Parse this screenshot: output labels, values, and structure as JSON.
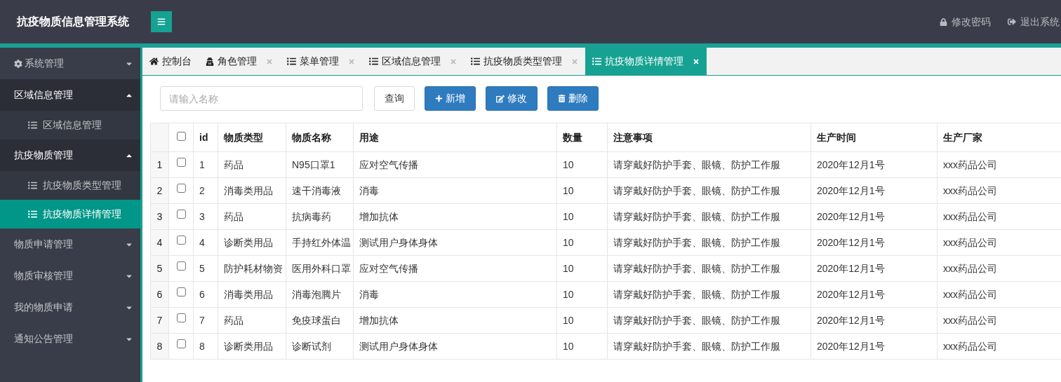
{
  "header": {
    "title": "抗疫物质信息管理系统",
    "links": [
      {
        "label": "修改密码"
      },
      {
        "label": "退出系统"
      }
    ]
  },
  "sidebar": {
    "items": [
      {
        "label": "系统管理",
        "expanded": false
      },
      {
        "label": "区域信息管理",
        "expanded": true,
        "children": [
          {
            "label": "区域信息管理",
            "selected": false
          }
        ]
      },
      {
        "label": "抗疫物质管理",
        "expanded": true,
        "children": [
          {
            "label": "抗疫物质类型管理",
            "selected": false
          },
          {
            "label": "抗疫物质详情管理",
            "selected": true
          }
        ]
      },
      {
        "label": "物质申请管理",
        "expanded": false
      },
      {
        "label": "物质审核管理",
        "expanded": false
      },
      {
        "label": "我的物质申请",
        "expanded": false
      },
      {
        "label": "通知公告管理",
        "expanded": false
      }
    ]
  },
  "tabs": [
    {
      "label": "控制台",
      "selected": false,
      "closable": false
    },
    {
      "label": "角色管理",
      "selected": false,
      "closable": true
    },
    {
      "label": "菜单管理",
      "selected": false,
      "closable": true
    },
    {
      "label": "区域信息管理",
      "selected": false,
      "closable": true
    },
    {
      "label": "抗疫物质类型管理",
      "selected": false,
      "closable": true
    },
    {
      "label": "抗疫物质详情管理",
      "selected": true,
      "closable": true
    }
  ],
  "toolbar": {
    "search": {
      "placeholder": "请输入名称"
    },
    "buttons": [
      {
        "label": "查询",
        "kind": "default"
      },
      {
        "label": "新增",
        "kind": "add"
      },
      {
        "label": "修改",
        "kind": "edit"
      },
      {
        "label": "删除",
        "kind": "delete"
      }
    ]
  },
  "table": {
    "columns": [
      "id",
      "物质类型",
      "物质名称",
      "用途",
      "数量",
      "注意事项",
      "生产时间",
      "生产厂家"
    ],
    "header_checked": false,
    "rows": [
      {
        "index": "1",
        "checked": false,
        "cells": [
          "1",
          "药品",
          "N95口罩1",
          "应对空气传播",
          "10",
          "请穿戴好防护手套、眼镜、防护工作服",
          "2020年12月1号",
          "xxx药品公司"
        ]
      },
      {
        "index": "2",
        "checked": false,
        "cells": [
          "2",
          "消毒类用品",
          "速干消毒液",
          "消毒",
          "10",
          "请穿戴好防护手套、眼镜、防护工作服",
          "2020年12月1号",
          "xxx药品公司"
        ]
      },
      {
        "index": "3",
        "checked": false,
        "cells": [
          "3",
          "药品",
          "抗病毒药",
          "增加抗体",
          "10",
          "请穿戴好防护手套、眼镜、防护工作服",
          "2020年12月1号",
          "xxx药品公司"
        ]
      },
      {
        "index": "4",
        "checked": false,
        "cells": [
          "4",
          "诊断类用品",
          "手持红外体温",
          "测试用户身体身体",
          "10",
          "请穿戴好防护手套、眼镜、防护工作服",
          "2020年12月1号",
          "xxx药品公司"
        ]
      },
      {
        "index": "5",
        "checked": false,
        "cells": [
          "5",
          "防护耗材物资",
          "医用外科口罩",
          "应对空气传播",
          "10",
          "请穿戴好防护手套、眼镜、防护工作服",
          "2020年12月1号",
          "xxx药品公司"
        ]
      },
      {
        "index": "6",
        "checked": false,
        "cells": [
          "6",
          "消毒类用品",
          "消毒泡腾片",
          "消毒",
          "10",
          "请穿戴好防护手套、眼镜、防护工作服",
          "2020年12月1号",
          "xxx药品公司"
        ]
      },
      {
        "index": "7",
        "checked": false,
        "cells": [
          "7",
          "药品",
          "免疫球蛋白",
          "增加抗体",
          "10",
          "请穿戴好防护手套、眼镜、防护工作服",
          "2020年12月1号",
          "xxx药品公司"
        ]
      },
      {
        "index": "8",
        "checked": false,
        "cells": [
          "8",
          "诊断类用品",
          "诊断试剂",
          "测试用户身体身体",
          "10",
          "请穿戴好防护手套、眼镜、防护工作服",
          "2020年12月1号",
          "xxx药品公司"
        ]
      }
    ]
  }
}
